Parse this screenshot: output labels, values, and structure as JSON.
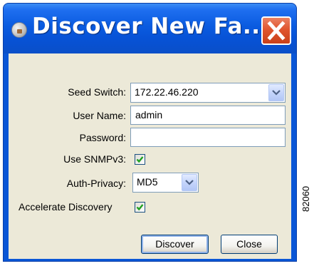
{
  "window": {
    "title": "Discover New Fa...",
    "icon": "fabric-switch-icon",
    "close_icon": "close-x-icon",
    "accent_color": "#0a56d6",
    "close_color": "#e0552e"
  },
  "form": {
    "seed_switch": {
      "label": "Seed Switch:",
      "value": "172.22.46.220"
    },
    "user_name": {
      "label": "User Name:",
      "value": "admin"
    },
    "password": {
      "label": "Password:",
      "value": ""
    },
    "use_snmpv3": {
      "label": "Use SNMPv3:",
      "checked": true
    },
    "auth_privacy": {
      "label": "Auth-Privacy:",
      "value": "MD5"
    },
    "accelerate_discovery": {
      "label": "Accelerate Discovery",
      "checked": true
    }
  },
  "buttons": {
    "discover": "Discover",
    "close": "Close"
  },
  "figure_id": "82060"
}
